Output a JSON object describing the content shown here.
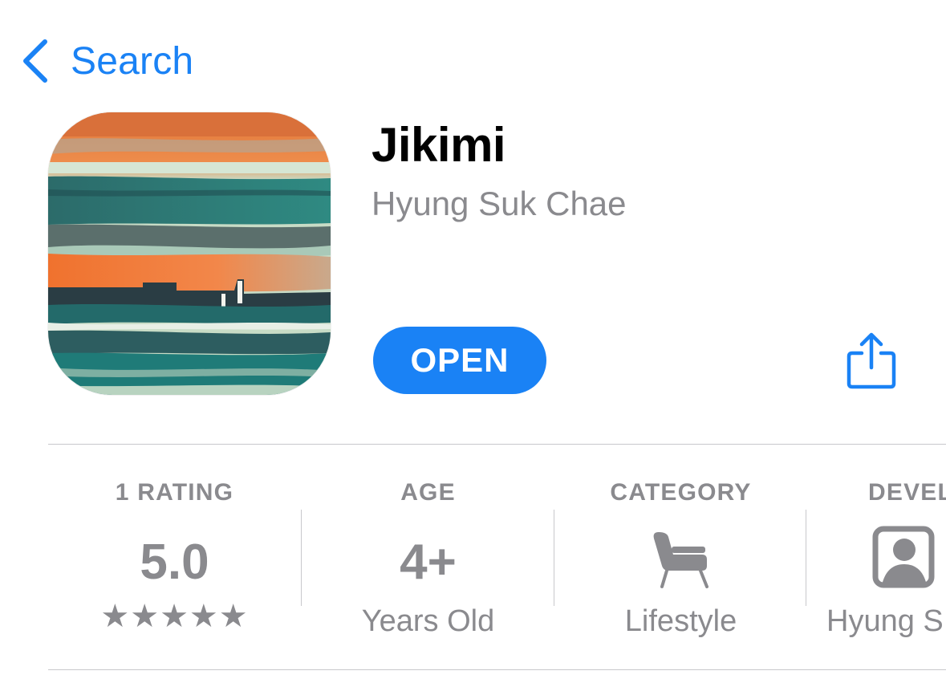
{
  "nav": {
    "back_label": "Search",
    "back_icon": "chevron-left-icon"
  },
  "app": {
    "title": "Jikimi",
    "developer": "Hyung Suk Chae",
    "open_label": "OPEN",
    "share_icon": "share-icon",
    "icon_image": "abstract landscape app icon"
  },
  "info": {
    "rating": {
      "caption": "1 RATING",
      "value": "5.0",
      "stars": "★★★★★",
      "star_count": 5
    },
    "age": {
      "caption": "AGE",
      "value": "4+",
      "sub": "Years Old"
    },
    "category": {
      "caption": "CATEGORY",
      "icon": "chair-icon",
      "sub": "Lifestyle"
    },
    "developer": {
      "caption": "DEVEL",
      "icon": "person-icon",
      "sub": "Hyung S"
    }
  },
  "colors": {
    "accent": "#1a82f5",
    "secondary_text": "#8a8a8e",
    "separator": "#c8c8cc"
  }
}
